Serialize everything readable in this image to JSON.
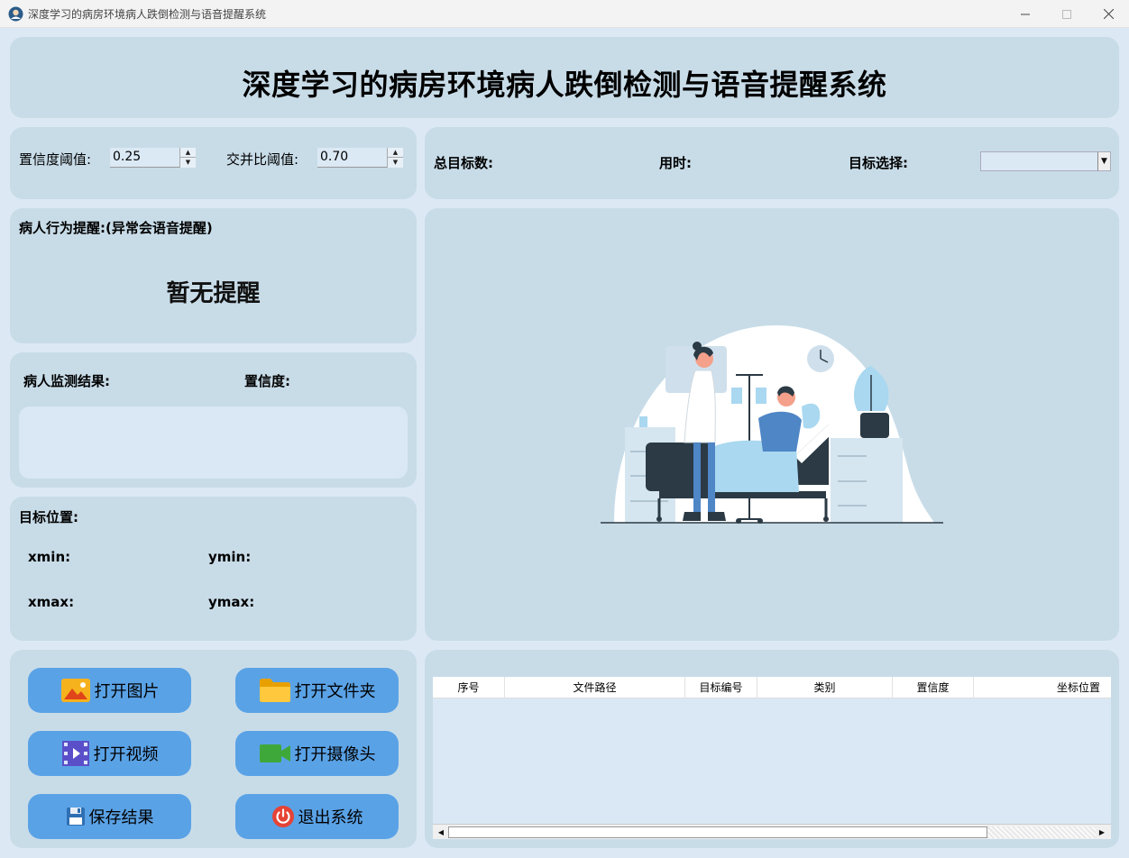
{
  "window": {
    "title": "深度学习的病房环境病人跌倒检测与语音提醒系统"
  },
  "header": {
    "title": "深度学习的病房环境病人跌倒检测与语音提醒系统"
  },
  "params": {
    "conf_label": "置信度阈值:",
    "conf_value": "0.25",
    "iou_label": "交并比阈值:",
    "iou_value": "0.70"
  },
  "stats": {
    "total_label": "总目标数:",
    "time_label": "用时:",
    "select_label": "目标选择:",
    "select_value": ""
  },
  "alert": {
    "title": "病人行为提醒:(异常会语音提醒)",
    "message": "暂无提醒"
  },
  "result": {
    "result_label": "病人监测结果:",
    "conf_label": "置信度:",
    "result_value": ""
  },
  "position": {
    "title": "目标位置:",
    "xmin": "xmin:",
    "ymin": "ymin:",
    "xmax": "xmax:",
    "ymax": "ymax:"
  },
  "buttons": {
    "open_image": "打开图片",
    "open_folder": "打开文件夹",
    "open_video": "打开视频",
    "open_camera": "打开摄像头",
    "save": "保存结果",
    "exit": "退出系统"
  },
  "table": {
    "columns": [
      "序号",
      "文件路径",
      "目标编号",
      "类别",
      "置信度",
      "坐标位置"
    ]
  },
  "colors": {
    "panel": "#c8dce8",
    "background": "#dce9f5",
    "button": "#5aa2e6",
    "inner": "#d9e8f4"
  }
}
